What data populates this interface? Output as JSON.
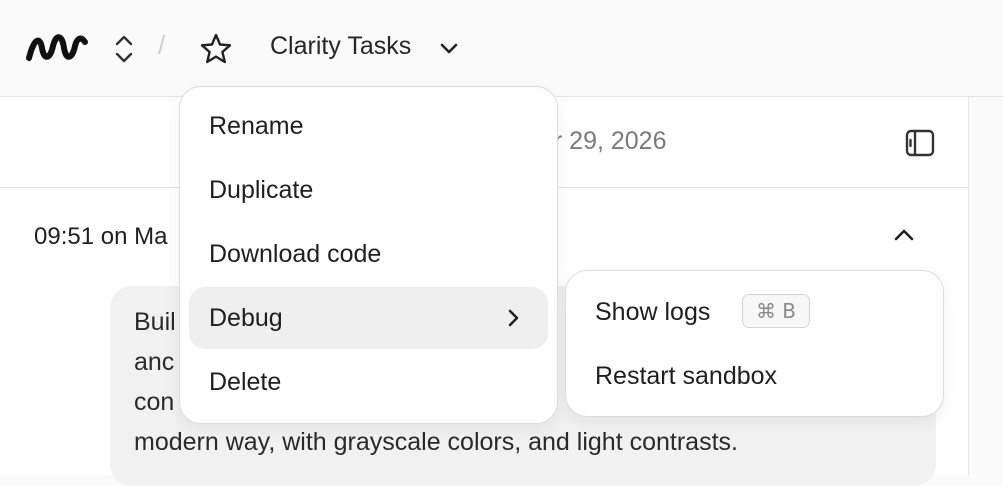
{
  "topbar": {
    "separator": "/",
    "project_name": "Clarity Tasks"
  },
  "content": {
    "date": "ar 29, 2026",
    "timestamp": "09:51 on Ma",
    "prompt_text": "Buil                                       v\nanc                                   e\ncon                                    C\nmodern way, with grayscale colors, and light contrasts."
  },
  "menu": {
    "items": [
      {
        "label": "Rename"
      },
      {
        "label": "Duplicate"
      },
      {
        "label": "Download code"
      },
      {
        "label": "Debug"
      },
      {
        "label": "Delete"
      }
    ]
  },
  "submenu": {
    "items": [
      {
        "label": "Show logs",
        "shortcut": "⌘ B"
      },
      {
        "label": "Restart sandbox"
      }
    ]
  },
  "icons": {
    "logo": "wave-logo-icon",
    "switcher": "chevron-up-down-icon",
    "favorite": "star-icon",
    "project_dropdown": "chevron-down-icon",
    "panel": "sidebar-panel-icon",
    "collapse": "chevron-up-icon",
    "submenu_arrow": "chevron-right-icon"
  }
}
